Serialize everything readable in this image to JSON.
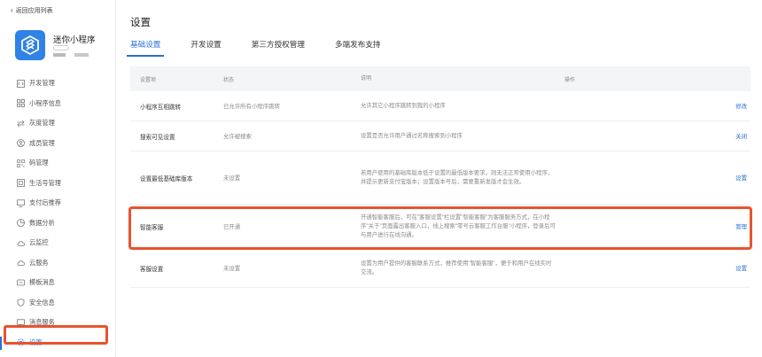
{
  "sidebar": {
    "back_label": "返回应用列表",
    "app_name": "迷你小程序",
    "items": [
      {
        "label": "开发管理",
        "icon": "code-box-icon"
      },
      {
        "label": "小程序信息",
        "icon": "grid-icon"
      },
      {
        "label": "灰度管理",
        "icon": "split-arrows-icon"
      },
      {
        "label": "成员管理",
        "icon": "user-circle-icon"
      },
      {
        "label": "码管理",
        "icon": "qrcode-icon"
      },
      {
        "label": "生活号管理",
        "icon": "store-icon"
      },
      {
        "label": "支付后推荐",
        "icon": "monitor-icon"
      },
      {
        "label": "数据分析",
        "icon": "pie-chart-icon"
      },
      {
        "label": "云监控",
        "icon": "cloud-icon"
      },
      {
        "label": "云服务",
        "icon": "cloud-icon"
      },
      {
        "label": "模板消息",
        "icon": "message-icon"
      },
      {
        "label": "安全信息",
        "icon": "shield-icon"
      },
      {
        "label": "消息服务",
        "icon": "chat-icon"
      },
      {
        "label": "设置",
        "icon": "gear-icon"
      }
    ]
  },
  "main": {
    "title": "设置",
    "tabs": [
      {
        "label": "基础设置",
        "active": true
      },
      {
        "label": "开发设置",
        "active": false
      },
      {
        "label": "第三方授权管理",
        "active": false
      },
      {
        "label": "多端发布支持",
        "active": false
      }
    ],
    "table": {
      "headers": [
        "设置项",
        "状态",
        "说明",
        "操作"
      ],
      "rows": [
        {
          "item": "小程序互相跳转",
          "status": "已允许所有小程序跳转",
          "desc": "允许其它小程序跳转到我的小程序",
          "action": "修改"
        },
        {
          "item": "搜索可见设置",
          "status": "允许被搜索",
          "desc": "设置是否允许用户通过名称搜索到小程序",
          "action": "关闭"
        },
        {
          "item": "设置最低基础库版本",
          "status": "未设置",
          "desc": "若用户使用的基础库版本低于设置的最低版本要求，则无法正常使用小程序，并提示更新支付宝版本；设置版本号后，需要重新发版才会生效。",
          "action": "设置"
        },
        {
          "item": "智能客服",
          "status": "已开通",
          "desc": "开通智能客服后，可在\"客服设置\"栏设置\"智能客服\"为客服服务方式，在小程序\"关于\"页面露出客服入口，线上搜索\"零号云客服工作台服\"小程序，登录后可与用户进行在线沟通。",
          "action": "管理"
        },
        {
          "item": "客服设置",
          "status": "未设置",
          "desc": "设置为用户提供的客服联系方式，推荐使用\"智能客服\"，便于和用户在线实时交流。",
          "action": "设置"
        }
      ]
    }
  },
  "colors": {
    "accent": "#2a6fd6",
    "highlight": "#e8532e",
    "logo": "#2f82e6"
  }
}
